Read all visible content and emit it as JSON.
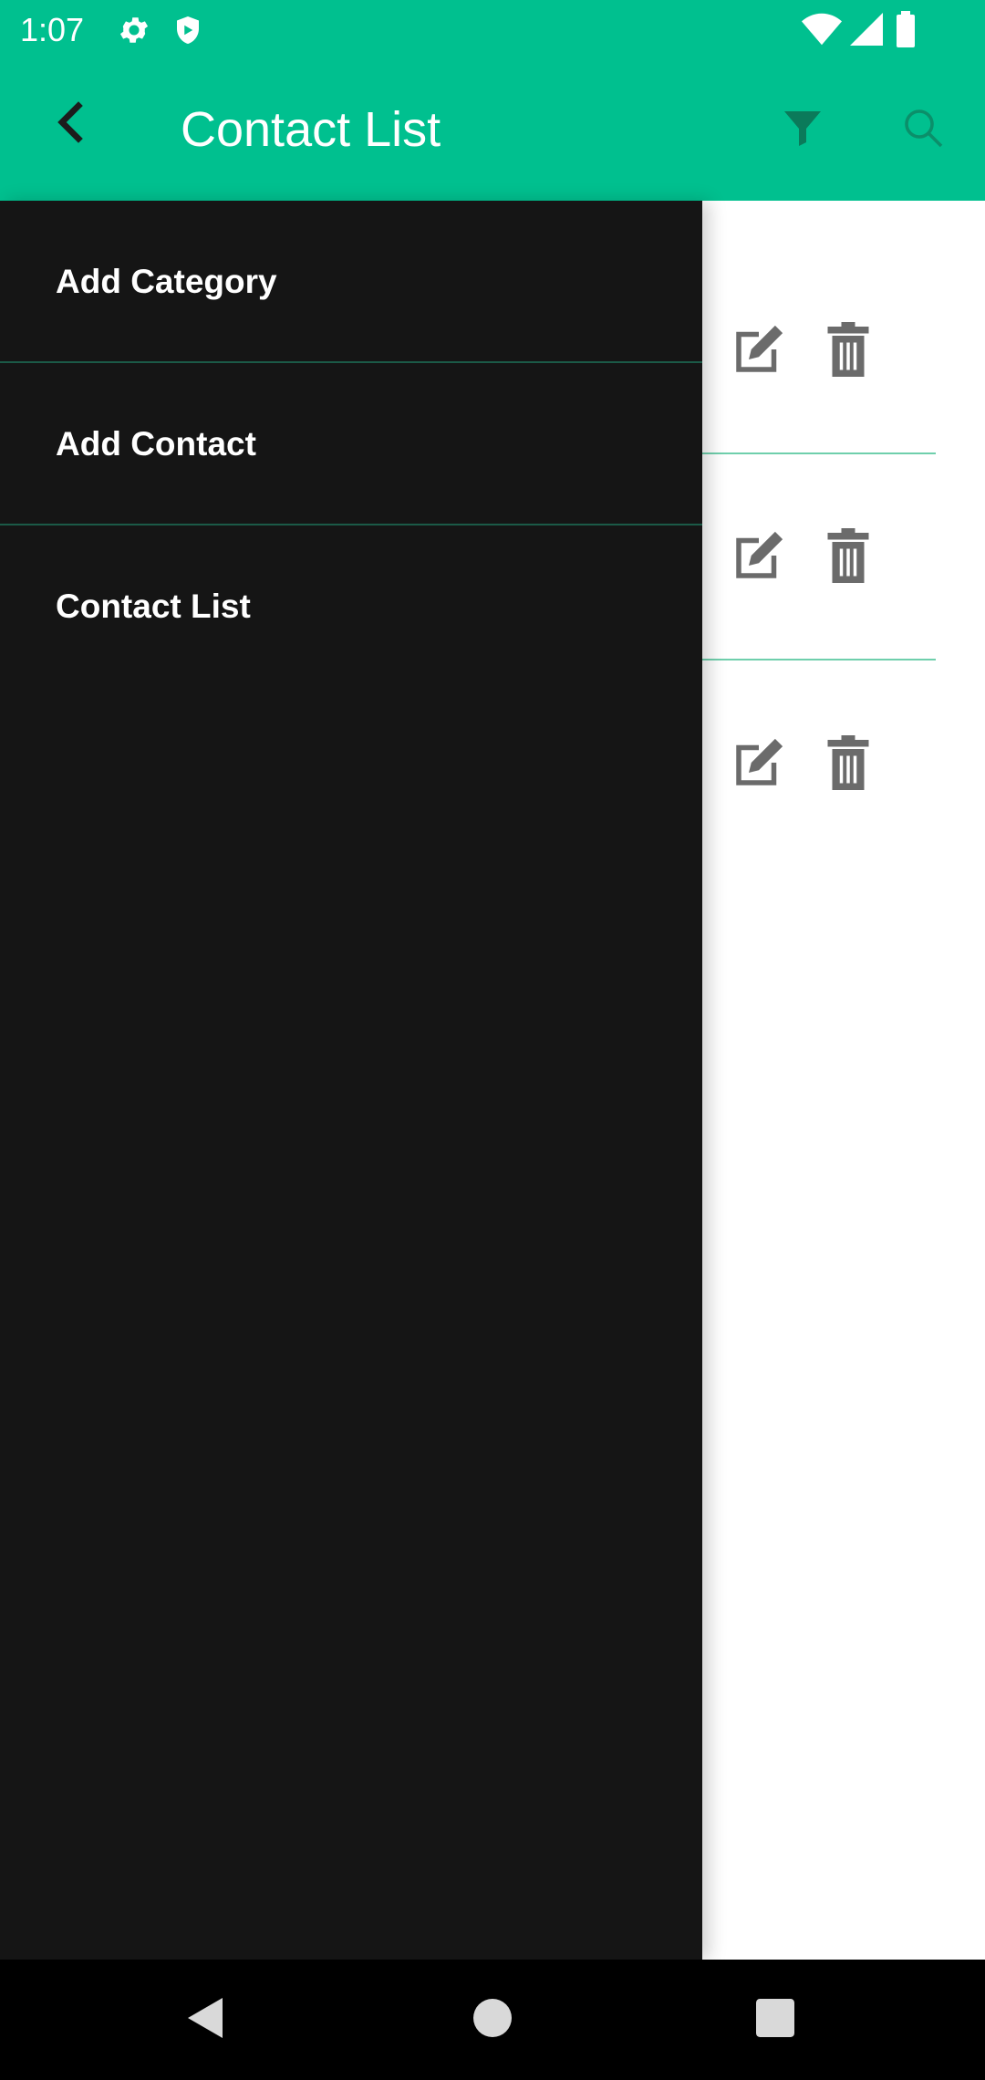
{
  "status_bar": {
    "time": "1:07",
    "icons": [
      "settings-icon",
      "shield-icon",
      "wifi-icon",
      "signal-icon",
      "battery-icon"
    ]
  },
  "app_bar": {
    "title": "Contact List",
    "background_color": "#00c08f",
    "icons": [
      "back-arrow-icon",
      "filter-icon",
      "search-icon"
    ]
  },
  "drawer": {
    "background_color": "#151515",
    "items": [
      {
        "label": "Add Category"
      },
      {
        "label": "Add Contact"
      },
      {
        "label": "Contact List"
      }
    ]
  },
  "contact_list": {
    "row_actions": [
      "edit-icon",
      "delete-icon"
    ],
    "divider_color": "#6fcfac"
  },
  "nav_bar": {
    "icons": [
      "back-triangle-icon",
      "home-circle-icon",
      "recents-square-icon"
    ]
  }
}
